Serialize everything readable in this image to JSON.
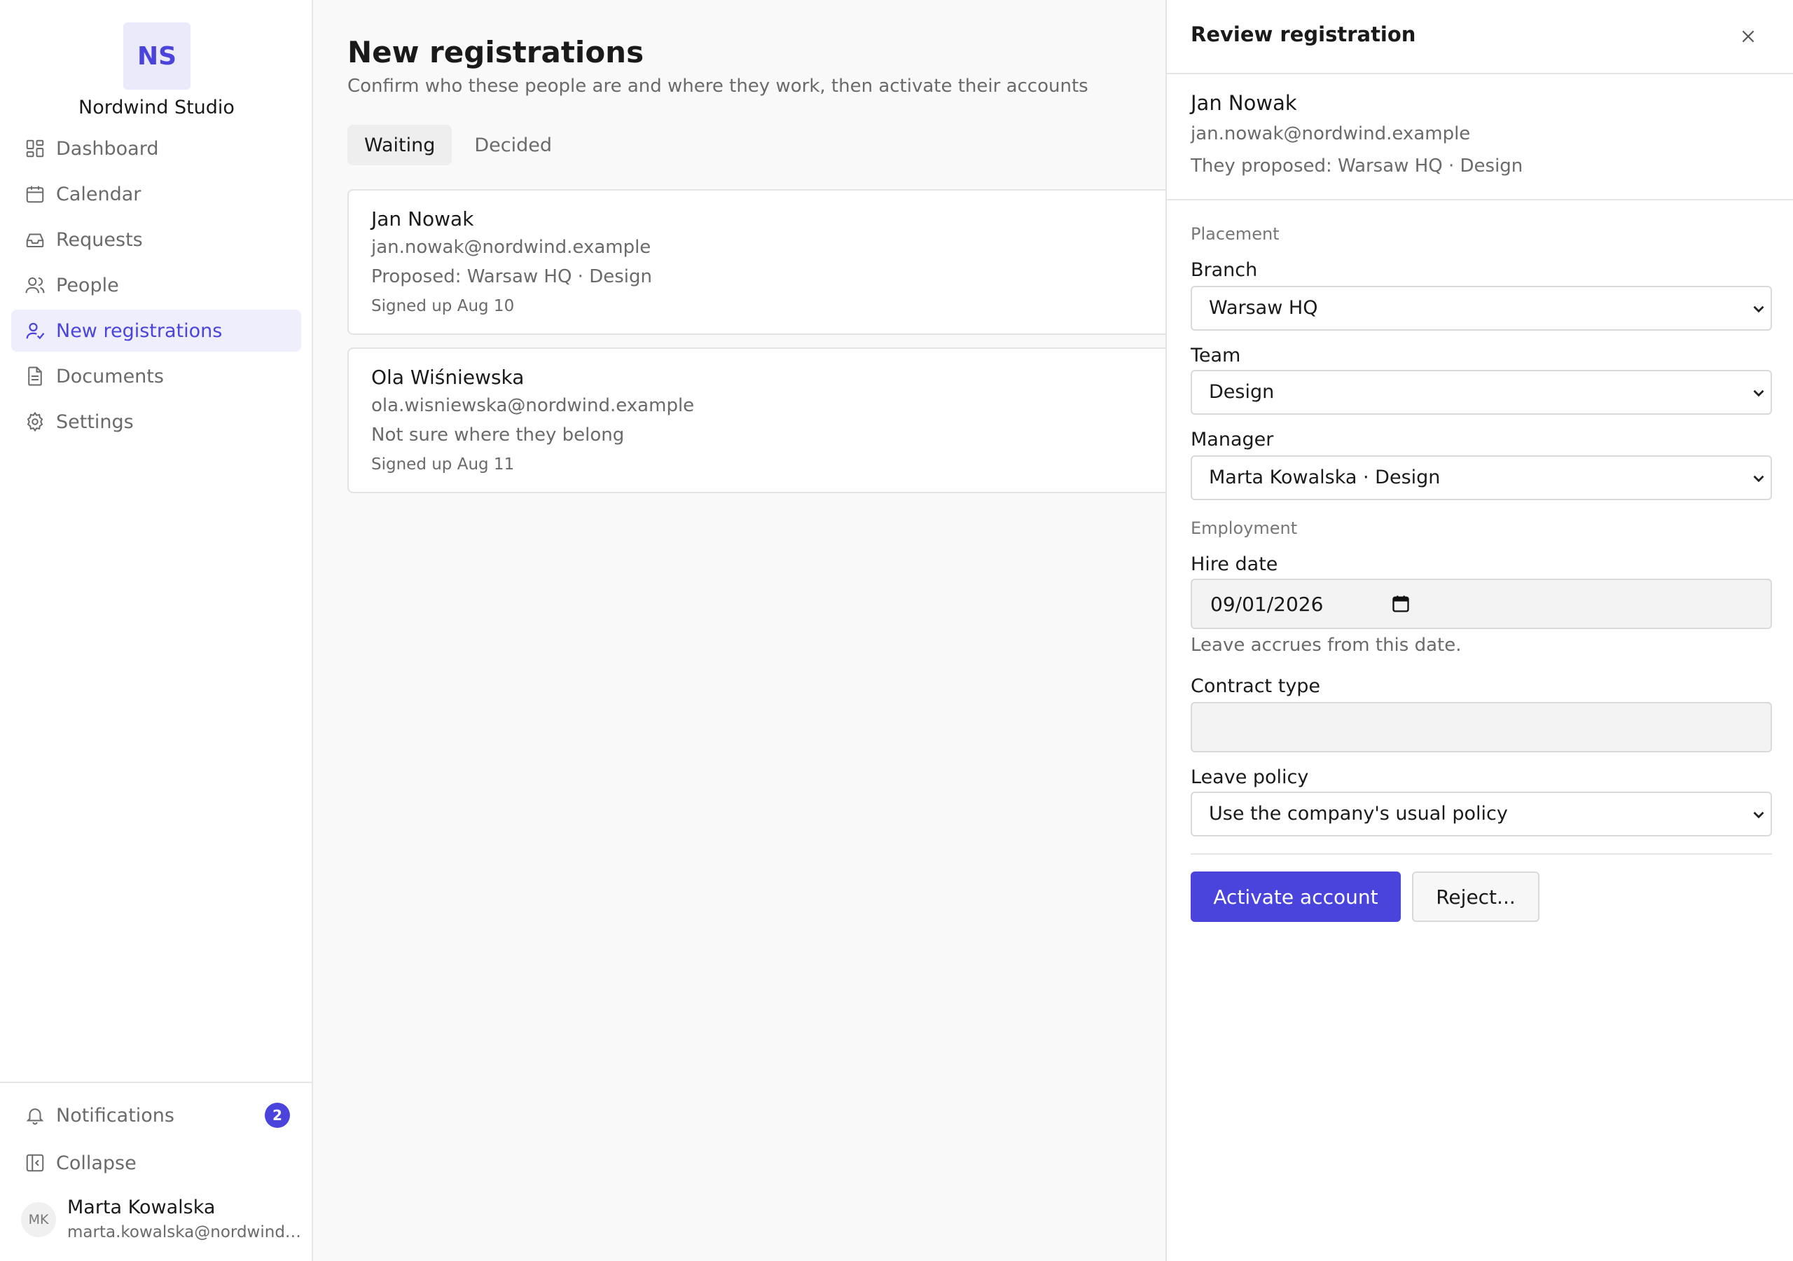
{
  "sidebar": {
    "logo_initials": "NS",
    "org_name": "Nordwind Studio",
    "items": [
      {
        "label": "Dashboard",
        "icon": "dashboard-icon"
      },
      {
        "label": "Calendar",
        "icon": "calendar-icon"
      },
      {
        "label": "Requests",
        "icon": "inbox-icon"
      },
      {
        "label": "People",
        "icon": "people-icon"
      },
      {
        "label": "New registrations",
        "icon": "user-check-icon",
        "active": true
      },
      {
        "label": "Documents",
        "icon": "document-icon"
      },
      {
        "label": "Settings",
        "icon": "gear-icon"
      }
    ],
    "notifications": {
      "label": "Notifications",
      "count": "2"
    },
    "collapse_label": "Collapse",
    "user": {
      "initials": "MK",
      "name": "Marta Kowalska",
      "email": "marta.kowalska@nordwind.example"
    }
  },
  "main": {
    "title": "New registrations",
    "subtitle": "Confirm who these people are and where they work, then activate their accounts",
    "tabs": [
      {
        "label": "Waiting",
        "active": true
      },
      {
        "label": "Decided",
        "active": false
      }
    ],
    "registrations": [
      {
        "name": "Jan Nowak",
        "email": "jan.nowak@nordwind.example",
        "proposal": "Proposed: Warsaw HQ · Design",
        "signed_up": "Signed up Aug 10"
      },
      {
        "name": "Ola Wiśniewska",
        "email": "ola.wisniewska@nordwind.example",
        "proposal": "Not sure where they belong",
        "signed_up": "Signed up Aug 11"
      }
    ]
  },
  "panel": {
    "title": "Review registration",
    "person": {
      "name": "Jan Nowak",
      "email": "jan.nowak@nordwind.example",
      "proposal": "They proposed: Warsaw HQ · Design"
    },
    "placement": {
      "section_label": "Placement",
      "branch_label": "Branch",
      "branch_value": "Warsaw HQ",
      "team_label": "Team",
      "team_value": "Design",
      "manager_label": "Manager",
      "manager_value": "Marta Kowalska · Design"
    },
    "employment": {
      "section_label": "Employment",
      "hire_date_label": "Hire date",
      "hire_date_value": "09/01/2026",
      "hire_date_help": "Leave accrues from this date.",
      "contract_label": "Contract type",
      "contract_value": "",
      "leave_policy_label": "Leave policy",
      "leave_policy_value": "Use the company's usual policy"
    },
    "actions": {
      "activate_label": "Activate account",
      "reject_label": "Reject..."
    }
  },
  "colors": {
    "accent": "#4b44dc",
    "accent_bg": "#efeefc"
  }
}
